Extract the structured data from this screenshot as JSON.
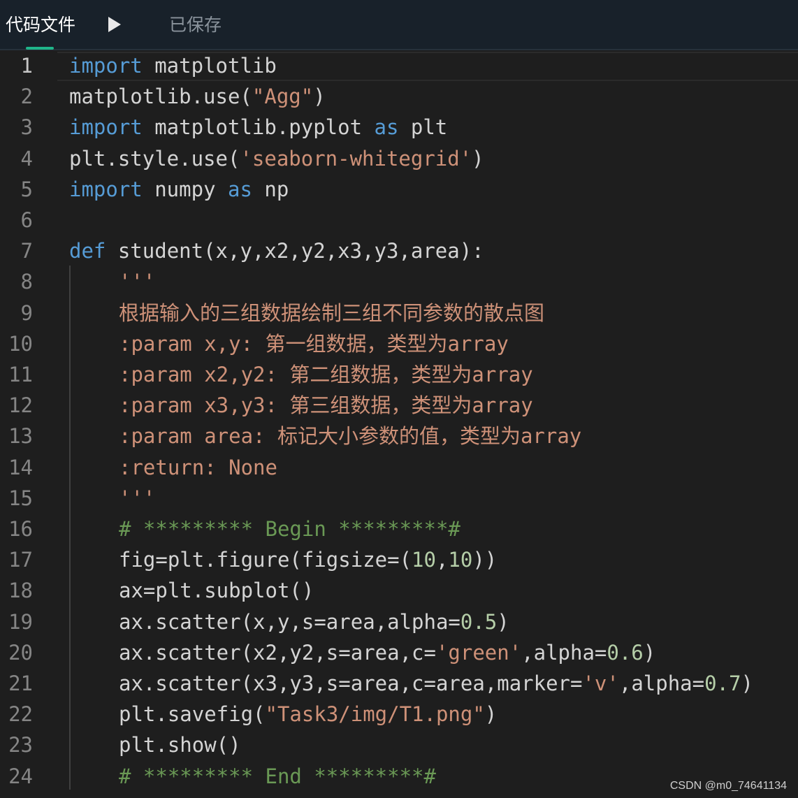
{
  "topbar": {
    "tab_label": "代码文件",
    "saved_status": "已保存",
    "run_icon": "play-triangle-icon",
    "accent_color": "#1fb58a"
  },
  "editor": {
    "active_line": 1,
    "lines": [
      {
        "number": "1",
        "tokens": [
          [
            "kw",
            "import"
          ],
          [
            "plain",
            " matplotlib"
          ]
        ]
      },
      {
        "number": "2",
        "tokens": [
          [
            "plain",
            "matplotlib.use("
          ],
          [
            "str",
            "\"Agg\""
          ],
          [
            "plain",
            ")"
          ]
        ]
      },
      {
        "number": "3",
        "tokens": [
          [
            "kw",
            "import"
          ],
          [
            "plain",
            " matplotlib.pyplot "
          ],
          [
            "kw",
            "as"
          ],
          [
            "plain",
            " plt"
          ]
        ]
      },
      {
        "number": "4",
        "tokens": [
          [
            "plain",
            "plt.style.use("
          ],
          [
            "str",
            "'seaborn-whitegrid'"
          ],
          [
            "plain",
            ")"
          ]
        ]
      },
      {
        "number": "5",
        "tokens": [
          [
            "kw",
            "import"
          ],
          [
            "plain",
            " numpy "
          ],
          [
            "kw",
            "as"
          ],
          [
            "plain",
            " np"
          ]
        ]
      },
      {
        "number": "6",
        "tokens": []
      },
      {
        "number": "7",
        "tokens": [
          [
            "kw",
            "def"
          ],
          [
            "plain",
            " student(x,y,x2,y2,x3,y3,area):"
          ]
        ]
      },
      {
        "number": "8",
        "indent": true,
        "tokens": [
          [
            "str",
            "'''"
          ]
        ]
      },
      {
        "number": "9",
        "indent": true,
        "tokens": [
          [
            "str",
            "根据输入的三组数据绘制三组不同参数的散点图"
          ]
        ]
      },
      {
        "number": "10",
        "indent": true,
        "tokens": [
          [
            "str",
            ":param x,y: 第一组数据，类型为array"
          ]
        ]
      },
      {
        "number": "11",
        "indent": true,
        "tokens": [
          [
            "str",
            ":param x2,y2: 第二组数据，类型为array"
          ]
        ]
      },
      {
        "number": "12",
        "indent": true,
        "tokens": [
          [
            "str",
            ":param x3,y3: 第三组数据，类型为array"
          ]
        ]
      },
      {
        "number": "13",
        "indent": true,
        "tokens": [
          [
            "str",
            ":param area: 标记大小参数的值，类型为array"
          ]
        ]
      },
      {
        "number": "14",
        "indent": true,
        "tokens": [
          [
            "str",
            ":return: None"
          ]
        ]
      },
      {
        "number": "15",
        "indent": true,
        "tokens": [
          [
            "str",
            "'''"
          ]
        ]
      },
      {
        "number": "16",
        "indent": true,
        "tokens": [
          [
            "cmt",
            "# ********* Begin *********#"
          ]
        ]
      },
      {
        "number": "17",
        "indent": true,
        "tokens": [
          [
            "plain",
            "fig=plt.figure(figsize=("
          ],
          [
            "num",
            "10"
          ],
          [
            "plain",
            ","
          ],
          [
            "num",
            "10"
          ],
          [
            "plain",
            "))"
          ]
        ]
      },
      {
        "number": "18",
        "indent": true,
        "tokens": [
          [
            "plain",
            "ax=plt.subplot()"
          ]
        ]
      },
      {
        "number": "19",
        "indent": true,
        "tokens": [
          [
            "plain",
            "ax.scatter(x,y,s=area,alpha="
          ],
          [
            "num",
            "0.5"
          ],
          [
            "plain",
            ")"
          ]
        ]
      },
      {
        "number": "20",
        "indent": true,
        "tokens": [
          [
            "plain",
            "ax.scatter(x2,y2,s=area,c="
          ],
          [
            "str",
            "'green'"
          ],
          [
            "plain",
            ",alpha="
          ],
          [
            "num",
            "0.6"
          ],
          [
            "plain",
            ")"
          ]
        ]
      },
      {
        "number": "21",
        "indent": true,
        "tokens": [
          [
            "plain",
            "ax.scatter(x3,y3,s=area,c=area,marker="
          ],
          [
            "str",
            "'v'"
          ],
          [
            "plain",
            ",alpha="
          ],
          [
            "num",
            "0.7"
          ],
          [
            "plain",
            ")"
          ]
        ]
      },
      {
        "number": "22",
        "indent": true,
        "tokens": [
          [
            "plain",
            "plt.savefig("
          ],
          [
            "str",
            "\"Task3/img/T1.png\""
          ],
          [
            "plain",
            ")"
          ]
        ]
      },
      {
        "number": "23",
        "indent": true,
        "tokens": [
          [
            "plain",
            "plt.show()"
          ]
        ]
      },
      {
        "number": "24",
        "indent": true,
        "tokens": [
          [
            "cmt",
            "# ********* End *********#"
          ]
        ]
      }
    ]
  },
  "watermark": "CSDN @m0_74641134"
}
